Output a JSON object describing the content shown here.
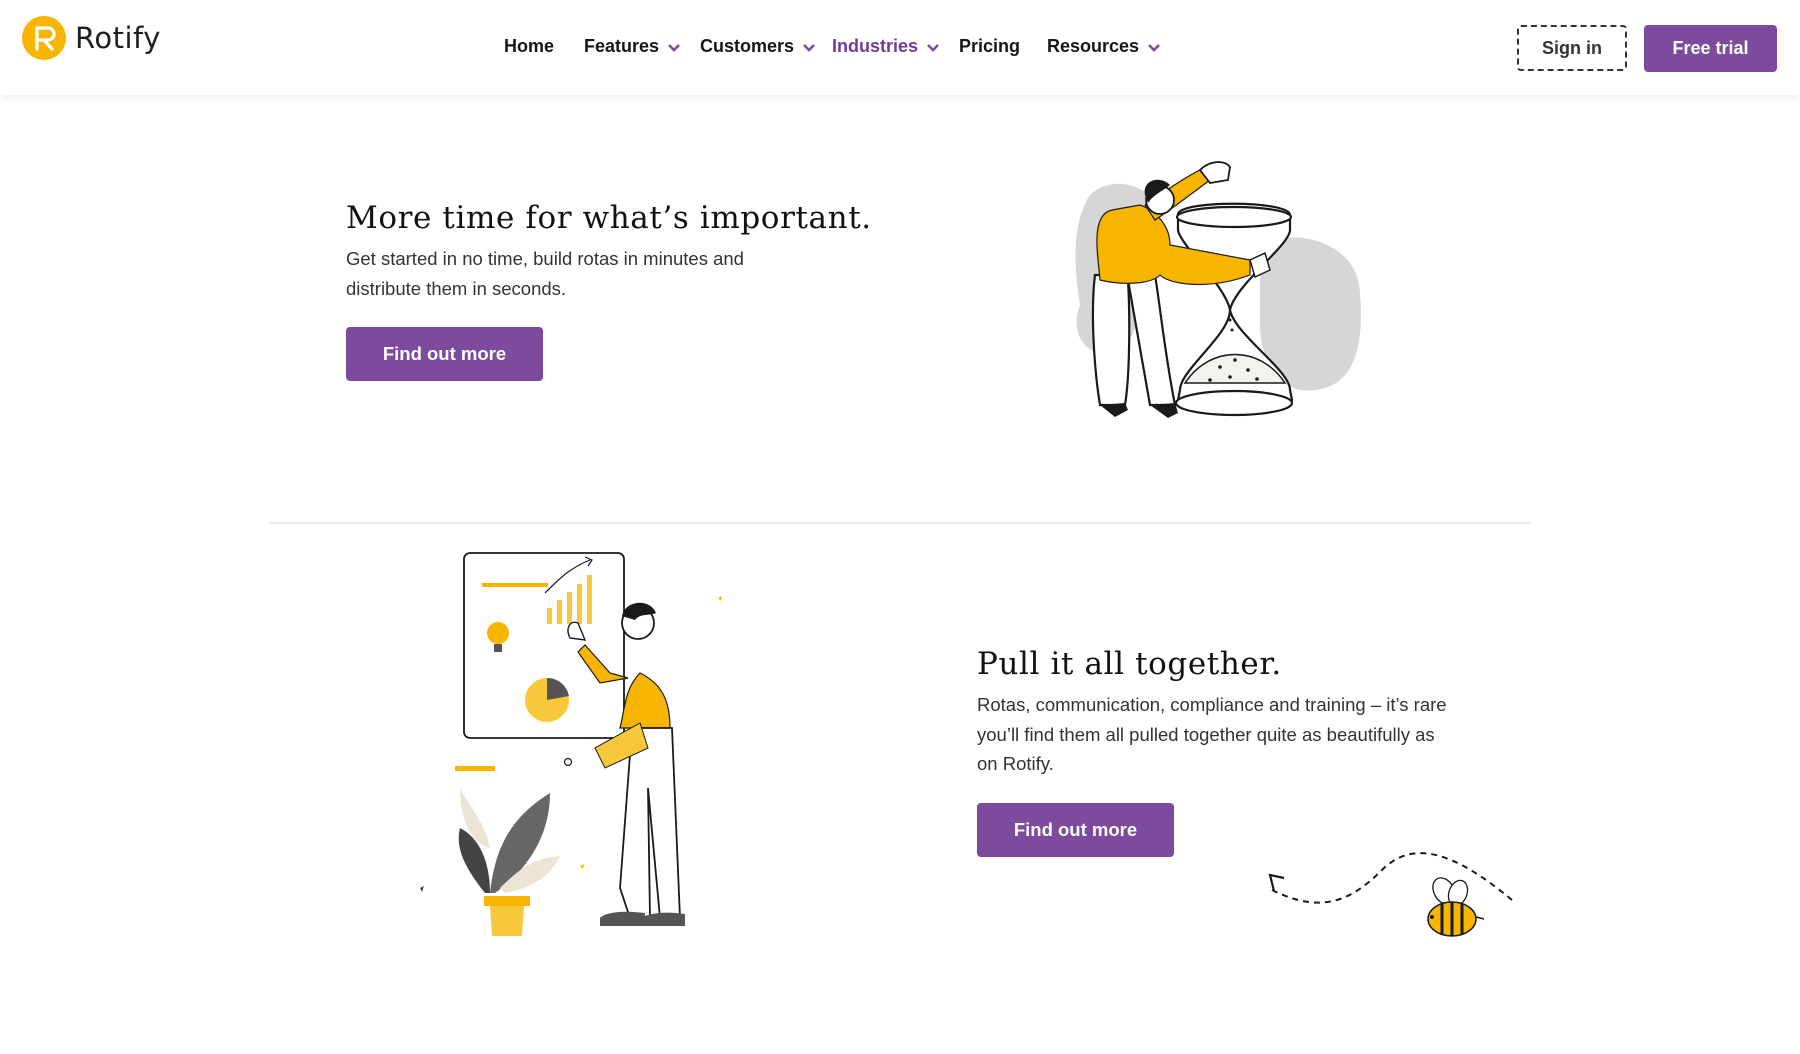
{
  "brand": {
    "name": "Rotify",
    "logo_color": "#f7b500",
    "accent_color": "#7c4b9e"
  },
  "nav": {
    "items": [
      {
        "label": "Home",
        "has_dropdown": false
      },
      {
        "label": "Features",
        "has_dropdown": true
      },
      {
        "label": "Customers",
        "has_dropdown": true
      },
      {
        "label": "Industries",
        "has_dropdown": true,
        "active": true
      },
      {
        "label": "Pricing",
        "has_dropdown": false
      },
      {
        "label": "Resources",
        "has_dropdown": true
      }
    ],
    "signin_label": "Sign in",
    "trial_label": "Free trial"
  },
  "sections": [
    {
      "heading": "More time for what’s important.",
      "body_lines": [
        "Get started in no time, build rotas in minutes and",
        "distribute them in seconds."
      ],
      "cta_label": "Find out more",
      "illustration": "hourglass-person-illustration"
    },
    {
      "heading": "Pull it all together.",
      "body_lines": [
        "Rotas, communication, compliance and training – it’s rare",
        "you’ll find them all pulled together quite as beautifully as",
        "on Rotify."
      ],
      "cta_label": "Find out more",
      "illustration": "presentation-person-illustration"
    }
  ],
  "decorations": {
    "bee": "bee-icon"
  }
}
